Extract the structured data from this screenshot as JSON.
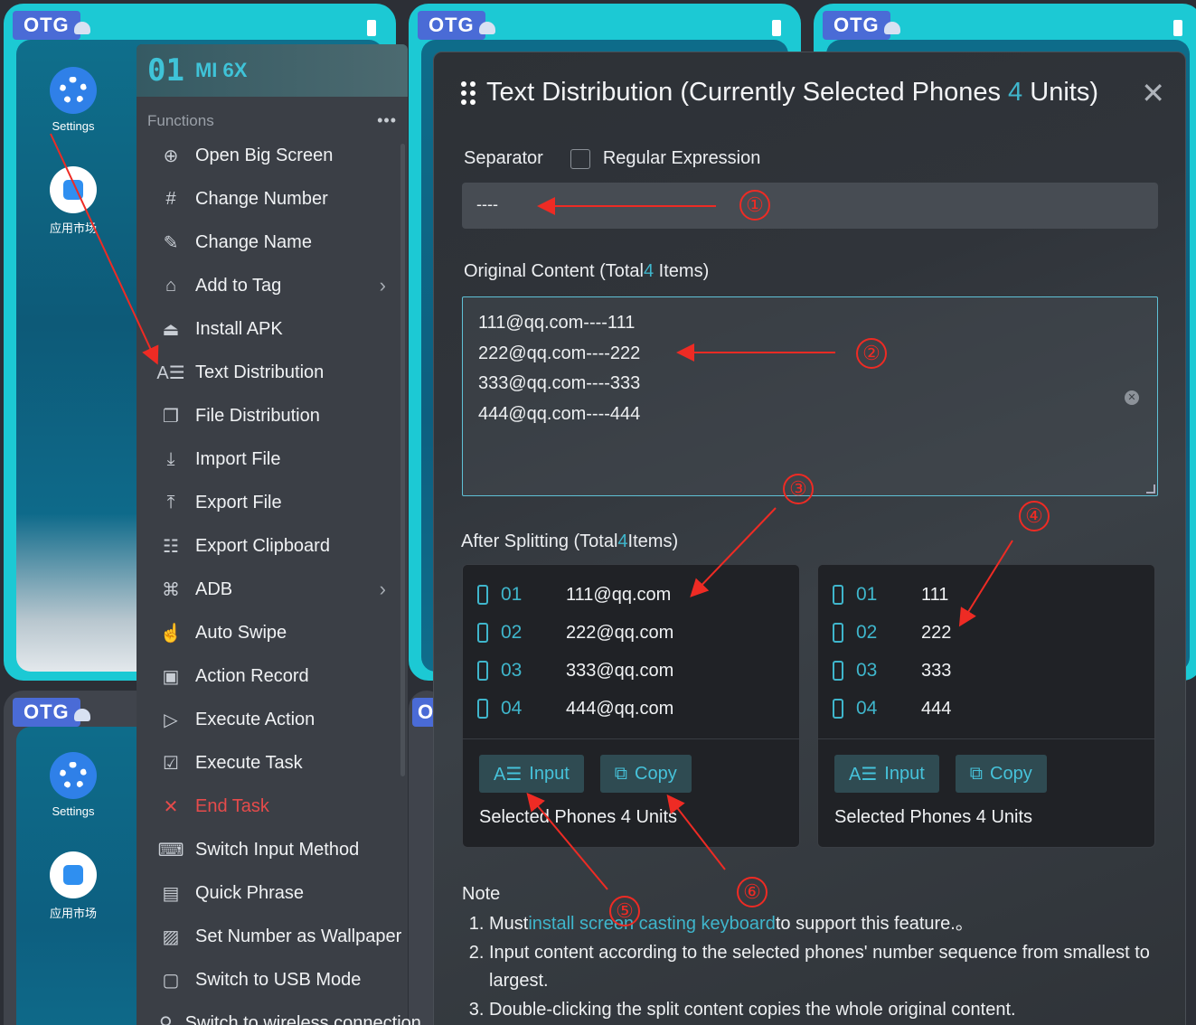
{
  "tiles": [
    {
      "badge": "OTG",
      "apps": [
        {
          "label": "Settings",
          "icon": "settings-icon"
        },
        {
          "label": "应用市场",
          "icon": "app-store-icon"
        }
      ]
    },
    {
      "badge": "OTG"
    },
    {
      "badge": "OTG"
    },
    {
      "badge": "OTG",
      "apps": [
        {
          "label": "Settings",
          "icon": "settings-icon"
        },
        {
          "label": "应用市场",
          "icon": "app-store-icon"
        }
      ]
    },
    {
      "badge": "O"
    }
  ],
  "menu": {
    "device_number": "01",
    "device_model": "MI 6X",
    "section_label": "Functions",
    "more": "•••",
    "items": [
      {
        "label": "Open Big Screen",
        "icon": "zoom-in-icon"
      },
      {
        "label": "Change Number",
        "icon": "hash-icon"
      },
      {
        "label": "Change Name",
        "icon": "pencil-icon"
      },
      {
        "label": "Add to Tag",
        "icon": "tag-icon",
        "submenu": true
      },
      {
        "label": "Install APK",
        "icon": "android-icon"
      },
      {
        "label": "Text Distribution",
        "icon": "text-format-icon"
      },
      {
        "label": "File Distribution",
        "icon": "file-copy-icon"
      },
      {
        "label": "Import File",
        "icon": "download-icon"
      },
      {
        "label": "Export File",
        "icon": "upload-icon"
      },
      {
        "label": "Export Clipboard",
        "icon": "clipboard-icon"
      },
      {
        "label": "ADB",
        "icon": "command-icon",
        "submenu": true
      },
      {
        "label": "Auto Swipe",
        "icon": "swipe-hand-icon"
      },
      {
        "label": "Action Record",
        "icon": "record-icon"
      },
      {
        "label": "Execute Action",
        "icon": "play-circle-icon"
      },
      {
        "label": "Execute Task",
        "icon": "task-check-icon"
      },
      {
        "label": "End Task",
        "icon": "close-x-icon",
        "danger": true
      },
      {
        "label": "Switch Input Method",
        "icon": "keyboard-icon"
      },
      {
        "label": "Quick Phrase",
        "icon": "message-icon"
      },
      {
        "label": "Set Number as Wallpaper",
        "icon": "image-icon"
      },
      {
        "label": "Switch to USB Mode",
        "icon": "usb-icon"
      },
      {
        "label": "Switch to wireless connection",
        "icon": "wireless-icon"
      }
    ]
  },
  "modal": {
    "title_prefix": "Text Distribution (Currently Selected Phones ",
    "title_count": "4",
    "title_suffix": " Units)",
    "close": "✕",
    "separator_label": "Separator",
    "regex_label": "Regular Expression",
    "separator_value": "----",
    "original_label_prefix": "Original Content (Total",
    "original_count": "4",
    "original_label_suffix": " Items)",
    "original_lines": [
      "111@qq.com----111",
      "222@qq.com----222",
      "333@qq.com----333",
      "444@qq.com----444"
    ],
    "split_label_prefix": "After Splitting (Total",
    "split_count": "4",
    "split_label_suffix": "Items)",
    "columns": [
      {
        "rows": [
          {
            "num": "01",
            "val": "111@qq.com"
          },
          {
            "num": "02",
            "val": "222@qq.com"
          },
          {
            "num": "03",
            "val": "333@qq.com"
          },
          {
            "num": "04",
            "val": "444@qq.com"
          }
        ],
        "input_label": "Input",
        "copy_label": "Copy",
        "selected": "Selected Phones 4 Units"
      },
      {
        "rows": [
          {
            "num": "01",
            "val": "111"
          },
          {
            "num": "02",
            "val": "222"
          },
          {
            "num": "03",
            "val": "333"
          },
          {
            "num": "04",
            "val": "444"
          }
        ],
        "input_label": "Input",
        "copy_label": "Copy",
        "selected": "Selected Phones 4 Units"
      }
    ],
    "note_title": "Note",
    "notes": {
      "n1_prefix": "Must",
      "n1_link": "install screen casting keyboard",
      "n1_suffix": "to support this feature.。",
      "n2": "Input content according to the selected phones' number sequence from smallest to largest.",
      "n3": "Double-clicking the split content copies the whole original content."
    }
  },
  "annotations": [
    "①",
    "②",
    "③",
    "④",
    "⑤",
    "⑥"
  ],
  "colors": {
    "accent": "#3fb6cc",
    "arrow": "#ee2b24",
    "otg_badge": "#4a6bd6",
    "tile_border": "#1cc9d4"
  }
}
